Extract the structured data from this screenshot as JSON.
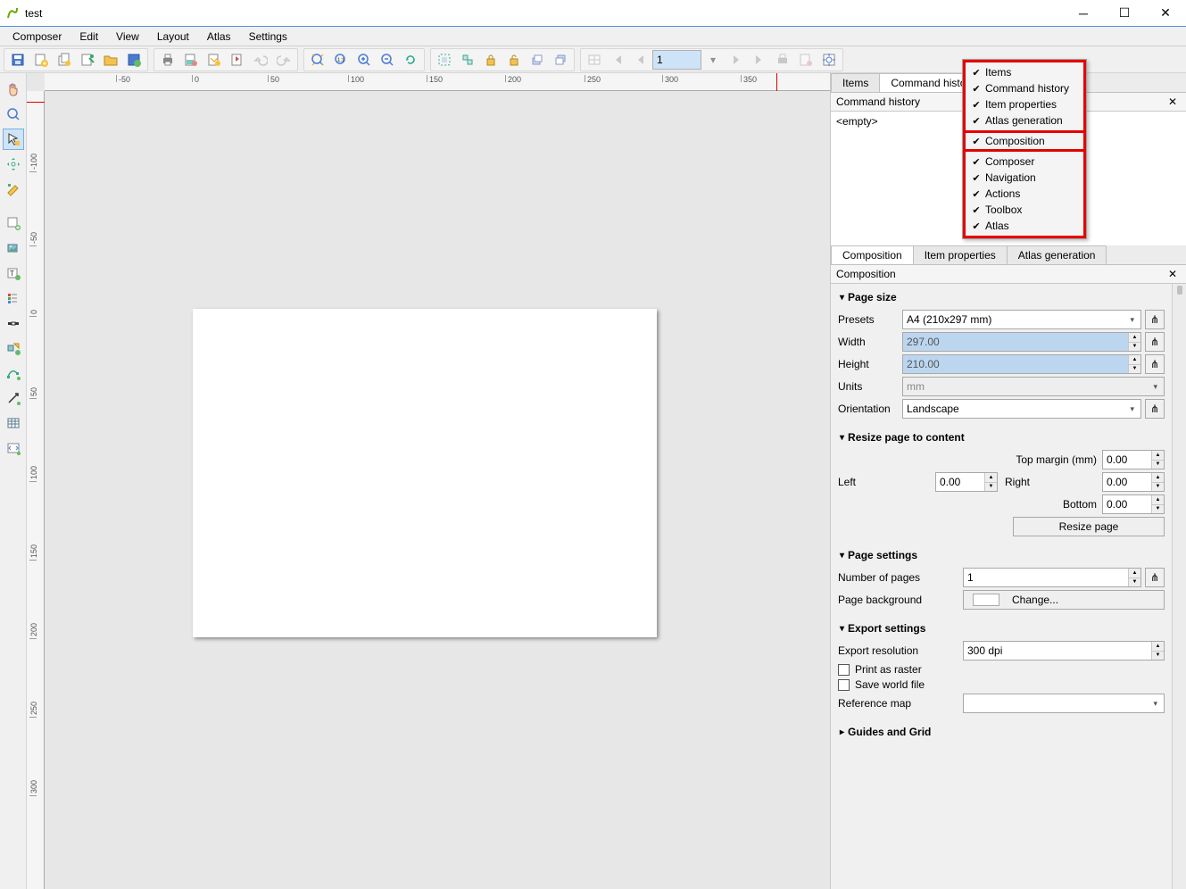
{
  "title": "test",
  "menu": [
    "Composer",
    "Edit",
    "View",
    "Layout",
    "Atlas",
    "Settings"
  ],
  "atlas_page": "1",
  "upper_tabs": {
    "items": "Items",
    "history": "Command history"
  },
  "history_panel": {
    "title": "Command history",
    "body": "<empty>"
  },
  "lower_tabs": {
    "composition": "Composition",
    "item_props": "Item properties",
    "atlas_gen": "Atlas generation"
  },
  "composition_panel_title": "Composition",
  "sections": {
    "page_size": {
      "head": "Page size",
      "presets_label": "Presets",
      "presets_value": "A4 (210x297 mm)",
      "width_label": "Width",
      "width_value": "297.00",
      "height_label": "Height",
      "height_value": "210.00",
      "units_label": "Units",
      "units_value": "mm",
      "orient_label": "Orientation",
      "orient_value": "Landscape"
    },
    "resize": {
      "head": "Resize page to content",
      "top_label": "Top margin (mm)",
      "top_value": "0.00",
      "left_label": "Left",
      "left_value": "0.00",
      "right_label": "Right",
      "right_value": "0.00",
      "bottom_label": "Bottom",
      "bottom_value": "0.00",
      "button": "Resize page"
    },
    "settings": {
      "head": "Page settings",
      "num_label": "Number of pages",
      "num_value": "1",
      "bg_label": "Page background",
      "bg_button": "Change..."
    },
    "export": {
      "head": "Export settings",
      "res_label": "Export resolution",
      "res_value": "300 dpi",
      "raster": "Print as raster",
      "world": "Save world file",
      "ref_label": "Reference map",
      "ref_value": ""
    },
    "guides": {
      "head": "Guides and Grid"
    }
  },
  "context": {
    "group1": [
      "Items",
      "Command history",
      "Item properties",
      "Atlas generation"
    ],
    "composition": "Composition",
    "group2": [
      "Composer",
      "Navigation",
      "Actions",
      "Toolbox",
      "Atlas"
    ]
  },
  "ruler_h": [
    "-50",
    "0",
    "50",
    "100",
    "150",
    "200",
    "250",
    "300",
    "350"
  ],
  "ruler_v": [
    "-100",
    "-50",
    "0",
    "50",
    "100",
    "150",
    "200",
    "250",
    "300"
  ]
}
